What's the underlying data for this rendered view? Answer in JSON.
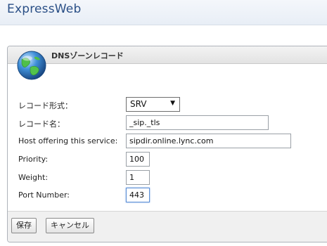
{
  "app": {
    "title": "ExpressWeb"
  },
  "dialog": {
    "title": "DNSゾーンレコード",
    "icon": "globe-icon"
  },
  "form": {
    "record_type_label": "レコード形式：",
    "record_type_value": "SRV",
    "record_name_label": "レコード名：",
    "record_name_value": "_sip._tls",
    "host_label": "Host offering this service:",
    "host_value": "sipdir.online.lync.com",
    "priority_label": "Priority:",
    "priority_value": "100",
    "weight_label": "Weight:",
    "weight_value": "1",
    "port_label": "Port Number:",
    "port_value": "443"
  },
  "buttons": {
    "save_label": "保存",
    "cancel_label": "キャンセル"
  },
  "colors": {
    "brand_title": "#2a4f86",
    "focus_border": "#5b8fd6"
  }
}
